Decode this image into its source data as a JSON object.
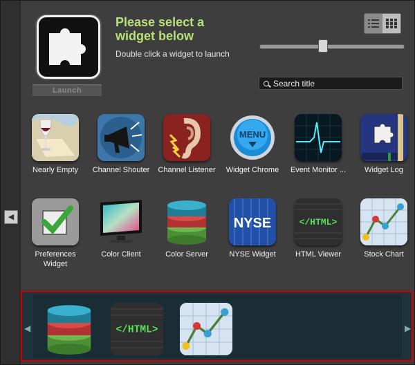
{
  "header": {
    "title": "Please select a widget below",
    "subtitle": "Double click a widget to launch",
    "launch_label": "Launch"
  },
  "search": {
    "placeholder": "Search title",
    "value": ""
  },
  "slider": {
    "level": 0.45
  },
  "view_toggle": {
    "list_icon": "list-view-icon",
    "grid_icon": "grid-view-icon",
    "active": "grid"
  },
  "widgets": [
    {
      "label": "Nearly Empty",
      "icon": "wine-glass-icon"
    },
    {
      "label": "Channel Shouter",
      "icon": "megaphone-icon"
    },
    {
      "label": "Channel Listener",
      "icon": "ear-icon"
    },
    {
      "label": "Widget Chrome",
      "icon": "menu-button-icon"
    },
    {
      "label": "Event Monitor ...",
      "icon": "heartbeat-monitor-icon"
    },
    {
      "label": "Widget Log",
      "icon": "puzzle-book-icon"
    },
    {
      "label": "Preferences Widget",
      "icon": "checkbox-icon"
    },
    {
      "label": "Color Client",
      "icon": "monitor-icon"
    },
    {
      "label": "Color Server",
      "icon": "database-icon"
    },
    {
      "label": "NYSE Widget",
      "icon": "nyse-icon"
    },
    {
      "label": "HTML Viewer",
      "icon": "html-tag-icon"
    },
    {
      "label": "Stock Chart",
      "icon": "line-chart-icon"
    }
  ],
  "dock": [
    {
      "icon": "database-icon"
    },
    {
      "icon": "html-tag-icon"
    },
    {
      "icon": "line-chart-icon"
    }
  ],
  "colors": {
    "title": "#b9e07a",
    "dock_border": "#d00000",
    "dock_bg": "#1f333d"
  },
  "html_text": "</HTML>",
  "nyse_text": "NYSE",
  "menu_text": "MENU"
}
